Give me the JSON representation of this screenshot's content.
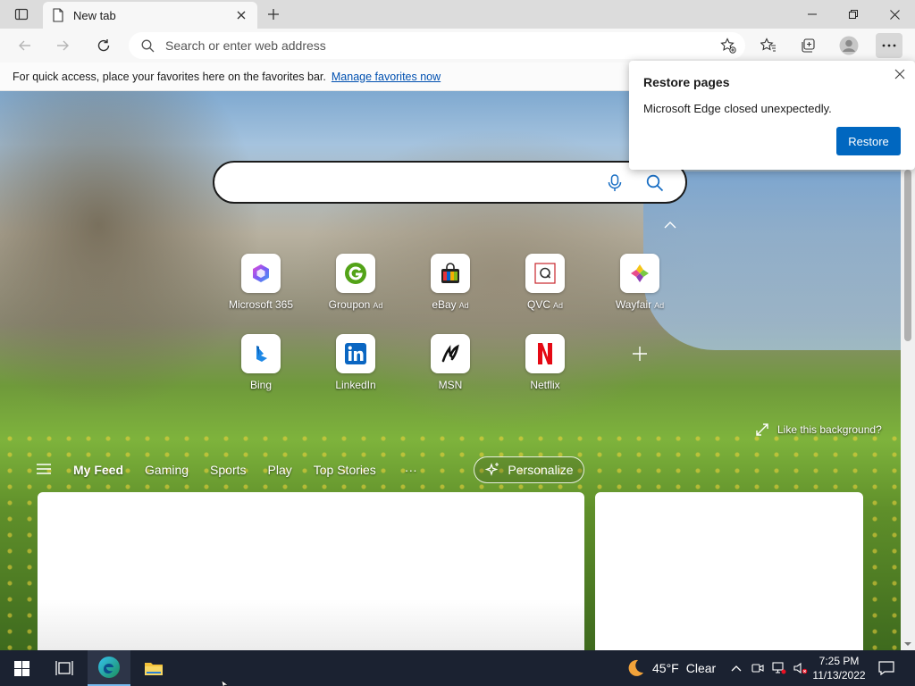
{
  "tab": {
    "title": "New tab"
  },
  "address": {
    "placeholder": "Search or enter web address"
  },
  "favorites_bar": {
    "text": "For quick access, place your favorites here on the favorites bar.",
    "link": "Manage favorites now"
  },
  "popup": {
    "title": "Restore pages",
    "message": "Microsoft Edge closed unexpectedly.",
    "button": "Restore"
  },
  "tiles": [
    {
      "label": "Microsoft 365",
      "ad": ""
    },
    {
      "label": "Groupon",
      "ad": "Ad"
    },
    {
      "label": "eBay",
      "ad": "Ad"
    },
    {
      "label": "QVC",
      "ad": "Ad"
    },
    {
      "label": "Wayfair",
      "ad": "Ad"
    },
    {
      "label": "Bing",
      "ad": ""
    },
    {
      "label": "LinkedIn",
      "ad": ""
    },
    {
      "label": "MSN",
      "ad": ""
    },
    {
      "label": "Netflix",
      "ad": ""
    }
  ],
  "background": {
    "like_text": "Like this background?"
  },
  "feed": {
    "items": [
      "My Feed",
      "Gaming",
      "Sports",
      "Play",
      "Top Stories"
    ],
    "more": "···",
    "personalize": "Personalize"
  },
  "taskbar": {
    "weather_temp": "45°F",
    "weather_desc": "Clear",
    "time": "7:25 PM",
    "date": "11/13/2022"
  },
  "colors": {
    "accent": "#0067c0",
    "taskbar": "#1b2231"
  },
  "icons": [
    "tab-actions-icon",
    "close-icon",
    "plus-icon",
    "minimize-icon",
    "maximize-icon",
    "back-icon",
    "forward-icon",
    "refresh-icon",
    "search-icon",
    "add-favorite-icon",
    "favorites-icon",
    "collections-icon",
    "profile-icon",
    "more-icon",
    "mic-icon",
    "expand-icon",
    "menu-icon",
    "sparkle-icon",
    "windows-icon",
    "task-view-icon",
    "edge-icon",
    "folder-icon",
    "moon-icon",
    "chevron-up-icon",
    "notification-icon"
  ]
}
